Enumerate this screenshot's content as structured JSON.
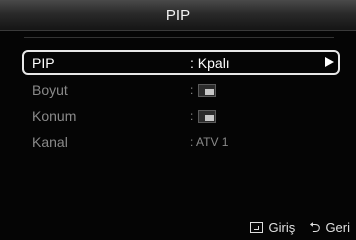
{
  "header": {
    "title": "PIP"
  },
  "menu": {
    "items": [
      {
        "label": "PIP",
        "value": ": Kpalı",
        "selected": true
      },
      {
        "label": "Boyut",
        "value": ":",
        "icon": "pip-size-icon"
      },
      {
        "label": "Konum",
        "value": ":",
        "icon": "pip-position-icon"
      },
      {
        "label": "Kanal",
        "value": ": ATV 1"
      }
    ]
  },
  "footer": {
    "enter_label": "Giriş",
    "enter_icon": "enter-icon",
    "back_label": "Geri",
    "back_icon": "return-icon"
  }
}
